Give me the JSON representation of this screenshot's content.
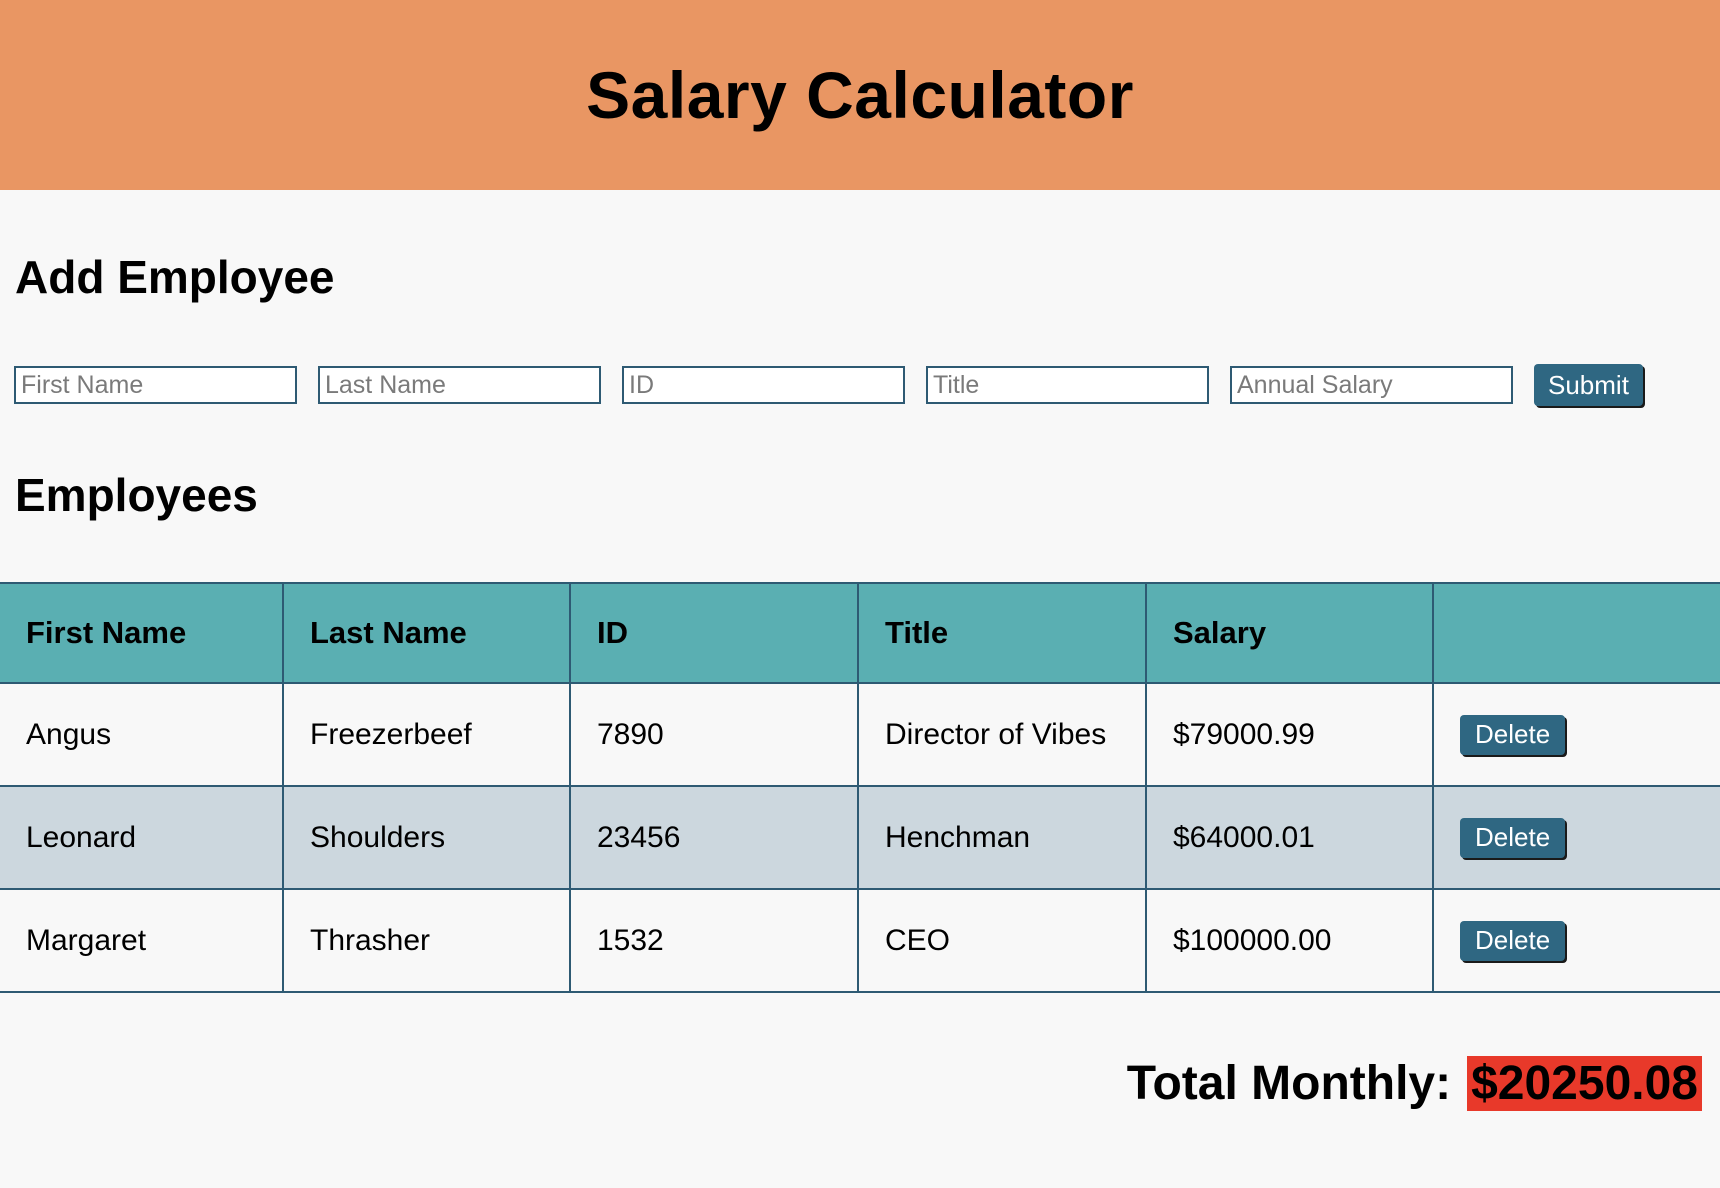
{
  "header": {
    "title": "Salary Calculator"
  },
  "add_section": {
    "title": "Add Employee",
    "placeholders": {
      "first_name": "First Name",
      "last_name": "Last Name",
      "id": "ID",
      "title": "Title",
      "annual_salary": "Annual Salary"
    },
    "submit_label": "Submit"
  },
  "employees_section": {
    "title": "Employees",
    "columns": [
      "First Name",
      "Last Name",
      "ID",
      "Title",
      "Salary",
      ""
    ],
    "rows": [
      {
        "first": "Angus",
        "last": "Freezerbeef",
        "id": "7890",
        "title": "Director of Vibes",
        "salary": "$79000.99"
      },
      {
        "first": "Leonard",
        "last": "Shoulders",
        "id": "23456",
        "title": "Henchman",
        "salary": "$64000.01"
      },
      {
        "first": "Margaret",
        "last": "Thrasher",
        "id": "1532",
        "title": "CEO",
        "salary": "$100000.00"
      }
    ],
    "delete_label": "Delete"
  },
  "total": {
    "label": "Total Monthly:",
    "amount": "$20250.08"
  },
  "colors": {
    "header_bg": "#e99663",
    "table_header_bg": "#5aafb2",
    "alt_row_bg": "#ccd7de",
    "button_bg": "#2f6782",
    "total_highlight": "#e8392a"
  }
}
